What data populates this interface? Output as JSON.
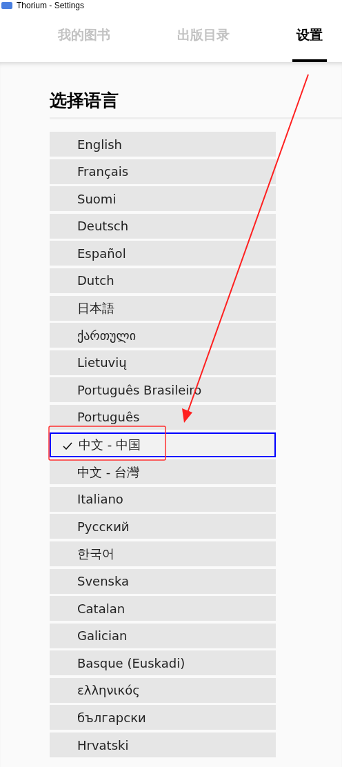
{
  "window": {
    "title": "Thorium - Settings"
  },
  "tabs": [
    {
      "label": "我的图书",
      "selected": false
    },
    {
      "label": "出版目录",
      "selected": false
    },
    {
      "label": "设置",
      "selected": true
    }
  ],
  "section": {
    "title": "选择语言"
  },
  "languages": [
    {
      "label": "English",
      "selected": false
    },
    {
      "label": "Français",
      "selected": false
    },
    {
      "label": "Suomi",
      "selected": false
    },
    {
      "label": "Deutsch",
      "selected": false
    },
    {
      "label": "Español",
      "selected": false
    },
    {
      "label": "Dutch",
      "selected": false
    },
    {
      "label": "日本語",
      "selected": false
    },
    {
      "label": "ქართული",
      "selected": false
    },
    {
      "label": "Lietuvių",
      "selected": false
    },
    {
      "label": "Português Brasileiro",
      "selected": false
    },
    {
      "label": "Português",
      "selected": false
    },
    {
      "label": "中文 - 中国",
      "selected": true
    },
    {
      "label": "中文 - 台灣",
      "selected": false
    },
    {
      "label": "Italiano",
      "selected": false
    },
    {
      "label": "Русский",
      "selected": false
    },
    {
      "label": "한국어",
      "selected": false
    },
    {
      "label": "Svenska",
      "selected": false
    },
    {
      "label": "Catalan",
      "selected": false
    },
    {
      "label": "Galician",
      "selected": false
    },
    {
      "label": "Basque (Euskadi)",
      "selected": false
    },
    {
      "label": "ελληνικός",
      "selected": false
    },
    {
      "label": "български",
      "selected": false
    },
    {
      "label": "Hrvatski",
      "selected": false
    }
  ]
}
